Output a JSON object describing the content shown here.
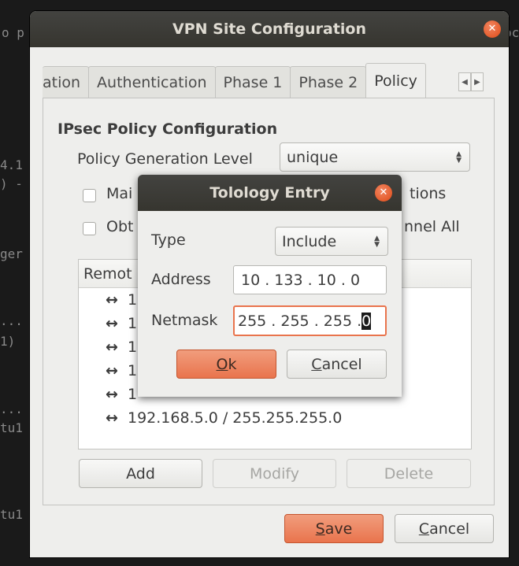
{
  "background_terminal": {
    "fragments": [
      "o p",
      "4.1",
      ") -",
      "ger",
      "...",
      "1)",
      "...",
      "tu1",
      "tu1",
      "oc"
    ]
  },
  "window": {
    "title": "VPN Site Configuration",
    "close_icon": "close-icon"
  },
  "tabs": [
    {
      "label": "ation"
    },
    {
      "label": "Authentication"
    },
    {
      "label": "Phase 1"
    },
    {
      "label": "Phase 2"
    },
    {
      "label": "Policy",
      "active": true
    }
  ],
  "tab_scroll": {
    "left": "◀",
    "right": "▶"
  },
  "policy": {
    "section_title": "IPsec Policy Configuration",
    "generation_label": "Policy Generation Level",
    "generation_value": "unique",
    "checkbox1_visible_start": "Mai",
    "checkbox1_visible_end": "tions",
    "checkbox2_visible_start": "Obt",
    "checkbox2_visible_end": "nnel All",
    "list_header": "Remot",
    "list_rows": [
      {
        "arrow": "↔",
        "text": "1"
      },
      {
        "arrow": "↔",
        "text": "1"
      },
      {
        "arrow": "↔",
        "text": "1"
      },
      {
        "arrow": "↔",
        "text": "1"
      },
      {
        "arrow": "↔",
        "text": "1"
      },
      {
        "arrow": "↔",
        "text": "192.168.5.0 / 255.255.255.0"
      }
    ],
    "add_label": "Add",
    "modify_label": "Modify",
    "delete_label": "Delete"
  },
  "footer": {
    "save_label": "Save",
    "save_mnemonic": "S",
    "save_rest": "ave",
    "cancel_mnemonic": "C",
    "cancel_rest": "ancel"
  },
  "dialog": {
    "title": "Tolology Entry",
    "type_label": "Type",
    "type_value": "Include",
    "address_label": "Address",
    "address_value": "10 . 133 . 10 . 0",
    "netmask_label": "Netmask",
    "netmask_value_main": "255 . 255 . 255 . ",
    "netmask_value_selected": "0",
    "ok_mnemonic": "O",
    "ok_rest": "k",
    "cancel_mnemonic": "C",
    "cancel_rest": "ancel"
  },
  "colors": {
    "accent": "#e9744d",
    "titlebar": "#3c3b37",
    "window_bg": "#eeeeec",
    "close_button": "#df4a16"
  }
}
